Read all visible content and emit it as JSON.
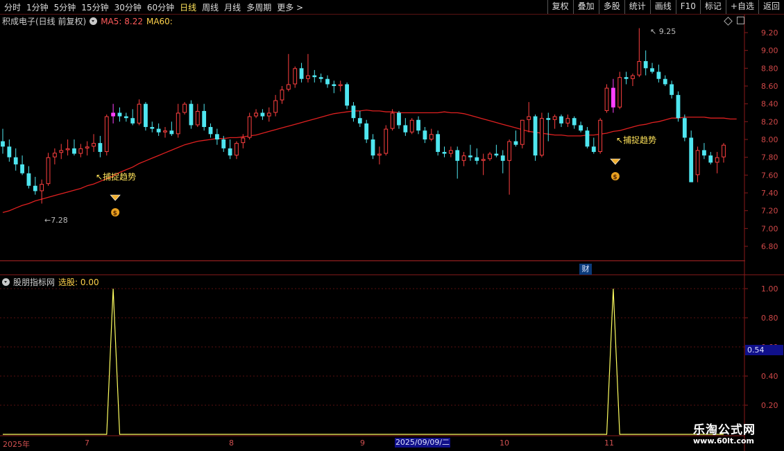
{
  "toolbar": {
    "periods": [
      "分时",
      "1分钟",
      "5分钟",
      "15分钟",
      "30分钟",
      "60分钟",
      "日线",
      "周线",
      "月线",
      "多周期",
      "更多 >"
    ],
    "active_period": "日线",
    "right_buttons": [
      "复权",
      "叠加",
      "多股",
      "统计",
      "画线",
      "F10",
      "标记",
      "+自选",
      "返回"
    ]
  },
  "main_chart": {
    "title": "积成电子(日线 前复权)",
    "ma5_label": "MA5: 8.22",
    "ma60_label": "MA60:",
    "y_ticks": [
      "9.20",
      "9.00",
      "8.80",
      "8.60",
      "8.40",
      "8.20",
      "8.00",
      "7.80",
      "7.60",
      "7.40",
      "7.20",
      "7.00",
      "6.80"
    ],
    "high_label": "9.25",
    "low_label": "7.28",
    "signal_text": "捕捉趋势",
    "finance_badge": "财",
    "colors": {
      "up": "#ff4040",
      "down": "#4fe6f0",
      "signal": "#ff40ff",
      "ma60": "#e02020",
      "axis": "#7a1a1a"
    }
  },
  "indicator_panel": {
    "title": "股朋指标网",
    "select_label": "选股: 0.00",
    "y_ticks": [
      "1.00",
      "0.80",
      "0.60",
      "0.40",
      "0.20"
    ],
    "current_value": "0.54"
  },
  "x_axis": {
    "labels": [
      "2025年",
      "7",
      "8",
      "9",
      "10",
      "11"
    ],
    "selected_date": "2025/09/09/二"
  },
  "watermark": {
    "line1": "乐淘公式网",
    "line2": "www.60lt.com"
  },
  "chart_data": {
    "type": "candlestick",
    "ohlc": [
      [
        7.98,
        8.12,
        7.84,
        7.92
      ],
      [
        7.92,
        8.0,
        7.75,
        7.8
      ],
      [
        7.8,
        7.9,
        7.65,
        7.72
      ],
      [
        7.72,
        7.82,
        7.6,
        7.62
      ],
      [
        7.62,
        7.7,
        7.45,
        7.48
      ],
      [
        7.48,
        7.58,
        7.38,
        7.42
      ],
      [
        7.42,
        7.55,
        7.28,
        7.5
      ],
      [
        7.5,
        7.85,
        7.48,
        7.8
      ],
      [
        7.8,
        7.9,
        7.72,
        7.85
      ],
      [
        7.85,
        7.95,
        7.78,
        7.88
      ],
      [
        7.88,
        8.0,
        7.82,
        7.9
      ],
      [
        7.9,
        8.0,
        7.82,
        7.84
      ],
      [
        7.84,
        7.95,
        7.8,
        7.9
      ],
      [
        7.9,
        7.98,
        7.82,
        7.92
      ],
      [
        7.92,
        8.06,
        7.86,
        7.96
      ],
      [
        7.96,
        8.04,
        7.8,
        7.86
      ],
      [
        7.86,
        8.28,
        7.82,
        8.26
      ],
      [
        8.26,
        8.4,
        8.18,
        8.3
      ],
      [
        8.3,
        8.36,
        8.2,
        8.26
      ],
      [
        8.26,
        8.3,
        8.2,
        8.24
      ],
      [
        8.24,
        8.34,
        8.16,
        8.18
      ],
      [
        8.18,
        8.45,
        8.16,
        8.4
      ],
      [
        8.4,
        8.42,
        8.1,
        8.14
      ],
      [
        8.14,
        8.2,
        8.08,
        8.12
      ],
      [
        8.12,
        8.18,
        8.04,
        8.08
      ],
      [
        8.08,
        8.14,
        8.02,
        8.1
      ],
      [
        8.1,
        8.2,
        8.04,
        8.06
      ],
      [
        8.06,
        8.4,
        8.02,
        8.3
      ],
      [
        8.3,
        8.42,
        8.28,
        8.4
      ],
      [
        8.4,
        8.44,
        8.12,
        8.16
      ],
      [
        8.16,
        8.4,
        8.14,
        8.32
      ],
      [
        8.32,
        8.4,
        8.1,
        8.14
      ],
      [
        8.14,
        8.18,
        8.02,
        8.06
      ],
      [
        8.06,
        8.12,
        7.94,
        8.0
      ],
      [
        8.0,
        8.04,
        7.86,
        7.9
      ],
      [
        7.9,
        8.0,
        7.78,
        7.82
      ],
      [
        7.82,
        7.98,
        7.78,
        7.96
      ],
      [
        7.96,
        8.06,
        7.9,
        8.02
      ],
      [
        8.02,
        8.3,
        8.0,
        8.26
      ],
      [
        8.26,
        8.34,
        8.24,
        8.3
      ],
      [
        8.3,
        8.34,
        8.22,
        8.26
      ],
      [
        8.26,
        8.36,
        8.2,
        8.3
      ],
      [
        8.3,
        8.5,
        8.26,
        8.44
      ],
      [
        8.44,
        8.6,
        8.4,
        8.56
      ],
      [
        8.56,
        8.96,
        8.54,
        8.62
      ],
      [
        8.62,
        8.82,
        8.58,
        8.8
      ],
      [
        8.8,
        8.86,
        8.64,
        8.68
      ],
      [
        8.68,
        8.96,
        8.64,
        8.72
      ],
      [
        8.72,
        8.78,
        8.64,
        8.7
      ],
      [
        8.7,
        8.74,
        8.64,
        8.68
      ],
      [
        8.68,
        8.72,
        8.58,
        8.62
      ],
      [
        8.62,
        8.66,
        8.52,
        8.6
      ],
      [
        8.6,
        8.66,
        8.54,
        8.62
      ],
      [
        8.62,
        8.64,
        8.34,
        8.38
      ],
      [
        8.38,
        8.42,
        8.2,
        8.24
      ],
      [
        8.24,
        8.32,
        8.14,
        8.18
      ],
      [
        8.18,
        8.22,
        7.96,
        8.0
      ],
      [
        8.0,
        8.06,
        7.78,
        7.82
      ],
      [
        7.82,
        7.92,
        7.72,
        7.84
      ],
      [
        7.84,
        8.16,
        7.82,
        8.12
      ],
      [
        8.12,
        8.34,
        8.1,
        8.3
      ],
      [
        8.3,
        8.32,
        8.12,
        8.16
      ],
      [
        8.16,
        8.24,
        8.04,
        8.08
      ],
      [
        8.08,
        8.24,
        8.06,
        8.22
      ],
      [
        8.22,
        8.26,
        8.06,
        8.1
      ],
      [
        8.1,
        8.14,
        7.96,
        8.0
      ],
      [
        8.0,
        8.12,
        7.98,
        8.06
      ],
      [
        8.06,
        8.1,
        7.82,
        7.86
      ],
      [
        7.86,
        7.92,
        7.8,
        7.84
      ],
      [
        7.84,
        7.92,
        7.8,
        7.88
      ],
      [
        7.88,
        7.92,
        7.56,
        7.76
      ],
      [
        7.76,
        7.86,
        7.7,
        7.82
      ],
      [
        7.82,
        7.94,
        7.76,
        7.8
      ],
      [
        7.8,
        7.9,
        7.72,
        7.76
      ],
      [
        7.76,
        7.84,
        7.6,
        7.78
      ],
      [
        7.78,
        7.86,
        7.76,
        7.84
      ],
      [
        7.84,
        7.94,
        7.8,
        7.82
      ],
      [
        7.82,
        7.88,
        7.62,
        7.76
      ],
      [
        7.76,
        8.0,
        7.38,
        7.98
      ],
      [
        7.98,
        8.1,
        7.92,
        7.94
      ],
      [
        7.94,
        8.22,
        7.9,
        8.22
      ],
      [
        8.22,
        8.42,
        8.08,
        8.26
      ],
      [
        8.26,
        8.28,
        7.76,
        7.82
      ],
      [
        7.82,
        8.3,
        7.8,
        8.24
      ],
      [
        8.24,
        8.3,
        7.98,
        8.22
      ],
      [
        8.22,
        8.28,
        8.12,
        8.26
      ],
      [
        8.26,
        8.28,
        8.14,
        8.18
      ],
      [
        8.18,
        8.28,
        8.14,
        8.24
      ],
      [
        8.24,
        8.26,
        8.12,
        8.16
      ],
      [
        8.16,
        8.2,
        8.08,
        8.1
      ],
      [
        8.1,
        8.14,
        7.9,
        7.92
      ],
      [
        7.92,
        8.02,
        7.84,
        7.86
      ],
      [
        7.86,
        8.24,
        7.84,
        8.22
      ],
      [
        8.32,
        8.62,
        8.3,
        8.58
      ],
      [
        8.58,
        8.68,
        8.3,
        8.36
      ],
      [
        8.36,
        8.76,
        8.34,
        8.7
      ],
      [
        8.7,
        8.76,
        8.62,
        8.68
      ],
      [
        8.68,
        8.74,
        8.6,
        8.72
      ],
      [
        8.72,
        9.25,
        8.7,
        8.88
      ],
      [
        8.88,
        9.0,
        8.72,
        8.8
      ],
      [
        8.8,
        8.86,
        8.74,
        8.76
      ],
      [
        8.76,
        8.84,
        8.64,
        8.68
      ],
      [
        8.68,
        8.72,
        8.6,
        8.62
      ],
      [
        8.62,
        8.66,
        8.46,
        8.5
      ],
      [
        8.5,
        8.54,
        8.2,
        8.24
      ],
      [
        8.24,
        8.28,
        7.98,
        8.02
      ],
      [
        8.02,
        8.1,
        7.52,
        7.52
      ],
      [
        7.6,
        7.92,
        7.52,
        7.88
      ],
      [
        7.88,
        7.96,
        7.78,
        7.82
      ],
      [
        7.82,
        7.86,
        7.72,
        7.74
      ],
      [
        7.74,
        7.86,
        7.62,
        7.8
      ],
      [
        7.8,
        7.96,
        7.74,
        7.94
      ]
    ],
    "signal_candles": [
      17,
      94
    ],
    "ma60": [
      7.18,
      7.2,
      7.23,
      7.26,
      7.28,
      7.31,
      7.33,
      7.35,
      7.37,
      7.39,
      7.41,
      7.43,
      7.45,
      7.48,
      7.5,
      7.53,
      7.56,
      7.59,
      7.63,
      7.66,
      7.69,
      7.73,
      7.76,
      7.79,
      7.82,
      7.85,
      7.88,
      7.91,
      7.94,
      7.96,
      7.98,
      7.99,
      8.0,
      8.01,
      8.01,
      8.02,
      8.02,
      8.03,
      8.04,
      8.05,
      8.07,
      8.09,
      8.11,
      8.13,
      8.15,
      8.17,
      8.19,
      8.21,
      8.23,
      8.25,
      8.27,
      8.29,
      8.3,
      8.31,
      8.32,
      8.32,
      8.33,
      8.32,
      8.32,
      8.31,
      8.31,
      8.3,
      8.3,
      8.3,
      8.3,
      8.3,
      8.3,
      8.3,
      8.31,
      8.3,
      8.3,
      8.29,
      8.27,
      8.25,
      8.23,
      8.21,
      8.19,
      8.17,
      8.15,
      8.13,
      8.11,
      8.09,
      8.08,
      8.07,
      8.06,
      8.05,
      8.05,
      8.04,
      8.04,
      8.04,
      8.05,
      8.05,
      8.06,
      8.07,
      8.09,
      8.1,
      8.12,
      8.14,
      8.16,
      8.17,
      8.19,
      8.2,
      8.22,
      8.24,
      8.24,
      8.25,
      8.25,
      8.25,
      8.25,
      8.24,
      8.24,
      8.24,
      8.23,
      8.23
    ],
    "indicator": {
      "name": "选股",
      "peaks_at": [
        17,
        94
      ],
      "values_range": [
        0,
        1
      ]
    },
    "y_range": [
      6.8,
      9.35
    ]
  }
}
